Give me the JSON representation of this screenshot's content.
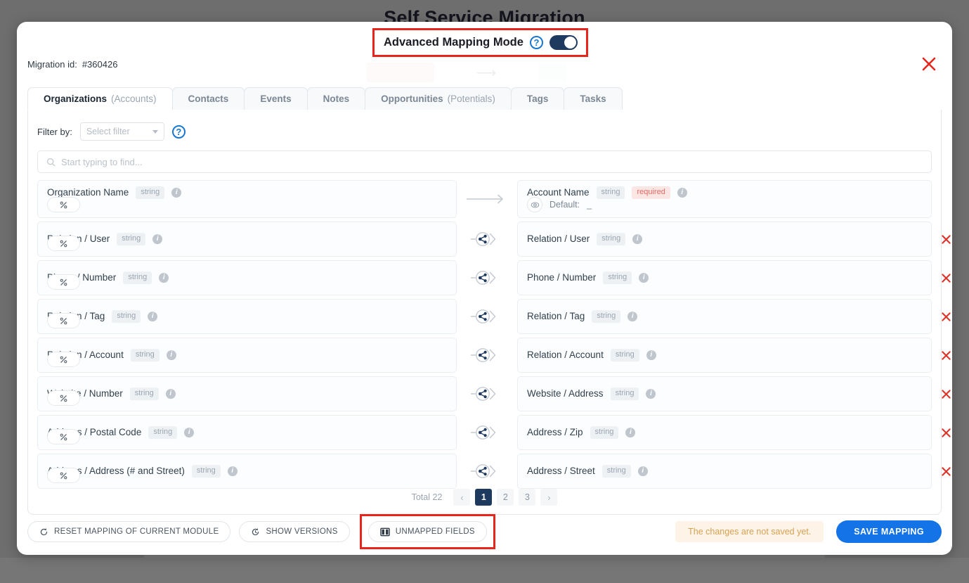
{
  "background": {
    "page_title": "Self Service Migration"
  },
  "modal": {
    "advanced_mapping": {
      "label": "Advanced Mapping Mode",
      "help_icon": "question-circle-icon",
      "toggle_state": "on",
      "highlighted": true
    },
    "close_icon": "close-icon",
    "migration_id_label": "Migration id:",
    "migration_id_value": "#360426"
  },
  "tabs": [
    {
      "label": "Organizations",
      "sub": "(Accounts)",
      "active": true
    },
    {
      "label": "Contacts",
      "sub": "",
      "active": false
    },
    {
      "label": "Events",
      "sub": "",
      "active": false
    },
    {
      "label": "Notes",
      "sub": "",
      "active": false
    },
    {
      "label": "Opportunities",
      "sub": "(Potentials)",
      "active": false
    },
    {
      "label": "Tags",
      "sub": "",
      "active": false
    },
    {
      "label": "Tasks",
      "sub": "",
      "active": false
    }
  ],
  "filter": {
    "label": "Filter by:",
    "select_value": "Select filter",
    "help_icon": "question-circle-icon"
  },
  "search": {
    "placeholder": "Start typing to find...",
    "value": "",
    "icon": "search-icon"
  },
  "mapping_rows": [
    {
      "source": {
        "name": "Organization Name",
        "type": "string",
        "info_icon": "info-icon",
        "pct_icon": "percent-icon"
      },
      "connector": "arrow",
      "target": {
        "name": "Account Name",
        "type": "string",
        "required": "required",
        "info_icon": "info-icon",
        "eye_icon": "eye-icon",
        "default_label": "Default:",
        "default_value": "_"
      },
      "deletable": false
    },
    {
      "source": {
        "name": "Relation / User",
        "type": "string",
        "info_icon": "info-icon",
        "pct_icon": "percent-icon"
      },
      "connector": "share-arrow",
      "target": {
        "name": "Relation / User",
        "type": "string",
        "info_icon": "info-icon"
      },
      "deletable": true,
      "delete_icon": "delete-x-icon"
    },
    {
      "source": {
        "name": "Phone / Number",
        "type": "string",
        "info_icon": "info-icon",
        "pct_icon": "percent-icon"
      },
      "connector": "share-arrow",
      "target": {
        "name": "Phone / Number",
        "type": "string",
        "info_icon": "info-icon"
      },
      "deletable": true,
      "delete_icon": "delete-x-icon"
    },
    {
      "source": {
        "name": "Relation / Tag",
        "type": "string",
        "info_icon": "info-icon",
        "pct_icon": "percent-icon"
      },
      "connector": "share-arrow",
      "target": {
        "name": "Relation / Tag",
        "type": "string",
        "info_icon": "info-icon"
      },
      "deletable": true,
      "delete_icon": "delete-x-icon"
    },
    {
      "source": {
        "name": "Relation / Account",
        "type": "string",
        "info_icon": "info-icon",
        "pct_icon": "percent-icon"
      },
      "connector": "share-arrow",
      "target": {
        "name": "Relation / Account",
        "type": "string",
        "info_icon": "info-icon"
      },
      "deletable": true,
      "delete_icon": "delete-x-icon"
    },
    {
      "source": {
        "name": "Website / Number",
        "type": "string",
        "info_icon": "info-icon",
        "pct_icon": "percent-icon"
      },
      "connector": "share-arrow",
      "target": {
        "name": "Website / Address",
        "type": "string",
        "info_icon": "info-icon"
      },
      "deletable": true,
      "delete_icon": "delete-x-icon"
    },
    {
      "source": {
        "name": "Address / Postal Code",
        "type": "string",
        "info_icon": "info-icon",
        "pct_icon": "percent-icon"
      },
      "connector": "share-arrow",
      "target": {
        "name": "Address / Zip",
        "type": "string",
        "info_icon": "info-icon"
      },
      "deletable": true,
      "delete_icon": "delete-x-icon"
    },
    {
      "source": {
        "name": "Address / Address (# and Street)",
        "type": "string",
        "info_icon": "info-icon",
        "pct_icon": "percent-icon"
      },
      "connector": "share-arrow",
      "target": {
        "name": "Address / Street",
        "type": "string",
        "info_icon": "info-icon"
      },
      "deletable": true,
      "delete_icon": "delete-x-icon"
    }
  ],
  "pagination": {
    "total_label": "Total 22",
    "prev": "‹",
    "next": "›",
    "pages": [
      "1",
      "2",
      "3"
    ],
    "active_page": "1"
  },
  "footer": {
    "reset_label": "RESET MAPPING OF CURRENT MODULE",
    "reset_icon": "reset-arrow-icon",
    "versions_label": "SHOW VERSIONS",
    "versions_icon": "history-icon",
    "unmapped_label": "UNMAPPED FIELDS",
    "unmapped_icon": "columns-icon",
    "unmapped_highlighted": true,
    "not_saved_text": "The changes are not saved yet.",
    "save_label": "SAVE MAPPING"
  },
  "colors": {
    "accent_blue": "#1473e6",
    "highlight_red": "#e8251c",
    "navy": "#1f3a5f",
    "required_red": "#e06a62",
    "warning_amber": "#d6a253"
  }
}
